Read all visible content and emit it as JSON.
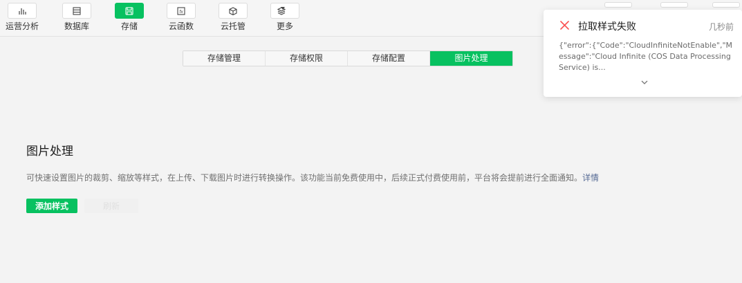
{
  "toolbar": {
    "items": [
      {
        "label": "运营分析",
        "icon": "bar-chart-icon"
      },
      {
        "label": "数据库",
        "icon": "database-icon"
      },
      {
        "label": "存储",
        "icon": "save-icon"
      },
      {
        "label": "云函数",
        "icon": "function-icon"
      },
      {
        "label": "云托管",
        "icon": "cube-icon"
      },
      {
        "label": "更多",
        "icon": "layers-icon"
      }
    ]
  },
  "tabs": [
    "存储管理",
    "存储权限",
    "存储配置",
    "图片处理"
  ],
  "main": {
    "title": "图片处理",
    "description": "可快速设置图片的裁剪、缩放等样式，在上传、下载图片时进行转换操作。该功能当前免费使用中，后续正式付费使用前，平台将会提前进行全面通知。",
    "details_link": "详情",
    "add_button": "添加样式",
    "refresh_button": "刷新"
  },
  "notification": {
    "title": "拉取样式失败",
    "time": "几秒前",
    "body": "{\"error\":{\"Code\":\"CloudInfiniteNotEnable\",\"Message\":\"Cloud Infinite (COS Data Processing Service) is..."
  },
  "colors": {
    "accent": "#07c160",
    "error": "#fa5151",
    "link": "#576b95"
  }
}
